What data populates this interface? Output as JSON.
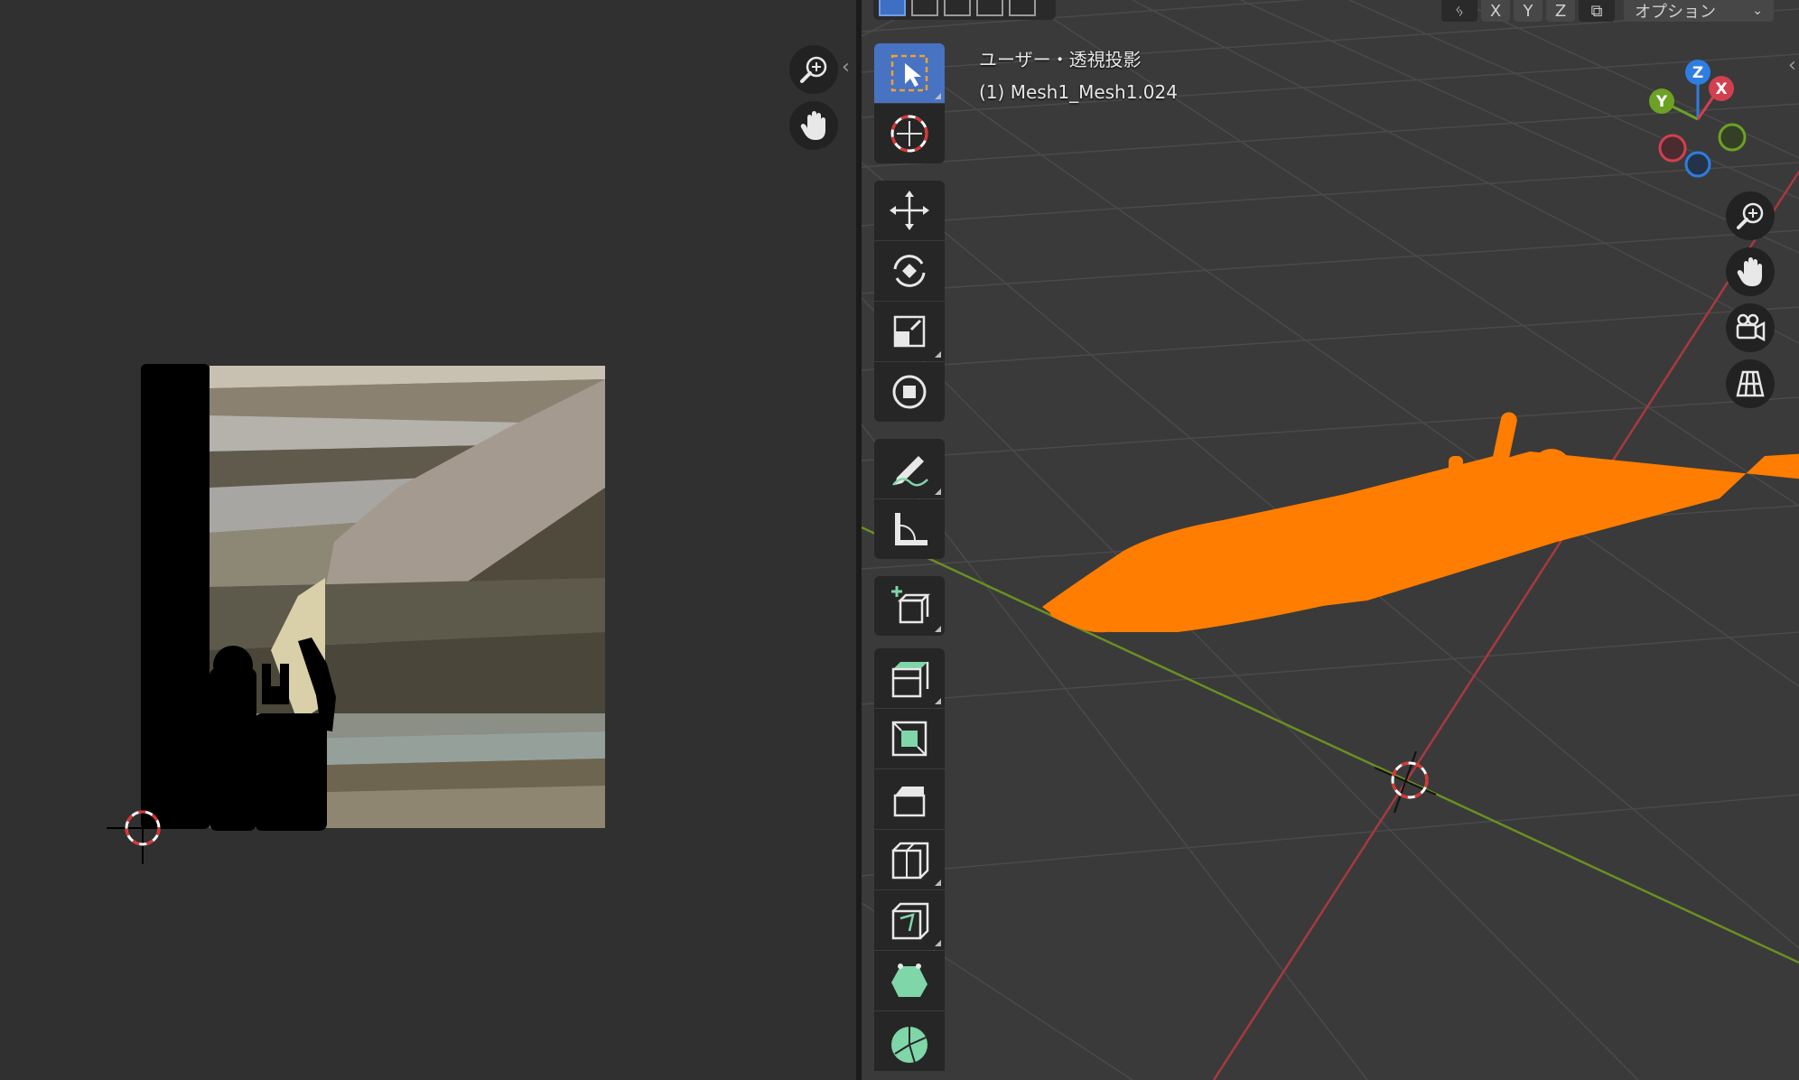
{
  "uv_editor": {
    "controls": [
      {
        "name": "zoom",
        "icon": "zoom-in-icon"
      },
      {
        "name": "pan",
        "icon": "hand-icon"
      }
    ],
    "collapse_icon": "chevron-left-icon"
  },
  "viewport": {
    "header": {
      "select_modes": [
        "select-new-icon",
        "select-extend-icon",
        "select-subtract-icon",
        "select-difference-icon",
        "select-intersect-icon"
      ],
      "mirror_icon": "butterfly-icon",
      "axis_x": "X",
      "axis_y": "Y",
      "axis_z": "Z",
      "options_label": "オプション"
    },
    "overlay": {
      "view_name": "ユーザー・透視投影",
      "object_name": "(1) Mesh1_Mesh1.024"
    },
    "gizmo": {
      "x": "X",
      "y": "Y",
      "z": "Z",
      "x_color": "#d2404f",
      "y_color": "#6ca125",
      "z_color": "#2f7de0"
    },
    "nav_controls": [
      "zoom-in-icon",
      "hand-icon",
      "camera-icon",
      "grid-view-icon"
    ],
    "tools": [
      {
        "name": "select-box",
        "icon": "cursor-select-icon",
        "active": true
      },
      {
        "name": "cursor",
        "icon": "3d-cursor-icon"
      },
      {
        "name": "move",
        "icon": "move-icon"
      },
      {
        "name": "rotate",
        "icon": "rotate-icon"
      },
      {
        "name": "scale",
        "icon": "scale-icon"
      },
      {
        "name": "transform",
        "icon": "transform-icon"
      },
      {
        "name": "annotate",
        "icon": "pencil-icon"
      },
      {
        "name": "measure",
        "icon": "ruler-icon"
      },
      {
        "name": "add-cube",
        "icon": "add-cube-icon"
      },
      {
        "name": "extrude",
        "icon": "extrude-icon"
      },
      {
        "name": "inset",
        "icon": "inset-icon"
      },
      {
        "name": "bevel",
        "icon": "bevel-icon"
      },
      {
        "name": "loop-cut",
        "icon": "loop-cut-icon"
      },
      {
        "name": "knife",
        "icon": "knife-icon"
      },
      {
        "name": "poly-build",
        "icon": "poly-build-icon"
      },
      {
        "name": "spin",
        "icon": "spin-icon"
      }
    ],
    "colors": {
      "selection": "#ff7d00",
      "x_axis_line": "#a8393f",
      "y_axis_line": "#6a8f23",
      "tool_icon_green": "#7fd6a8",
      "active_tool": "#4773c2"
    }
  }
}
